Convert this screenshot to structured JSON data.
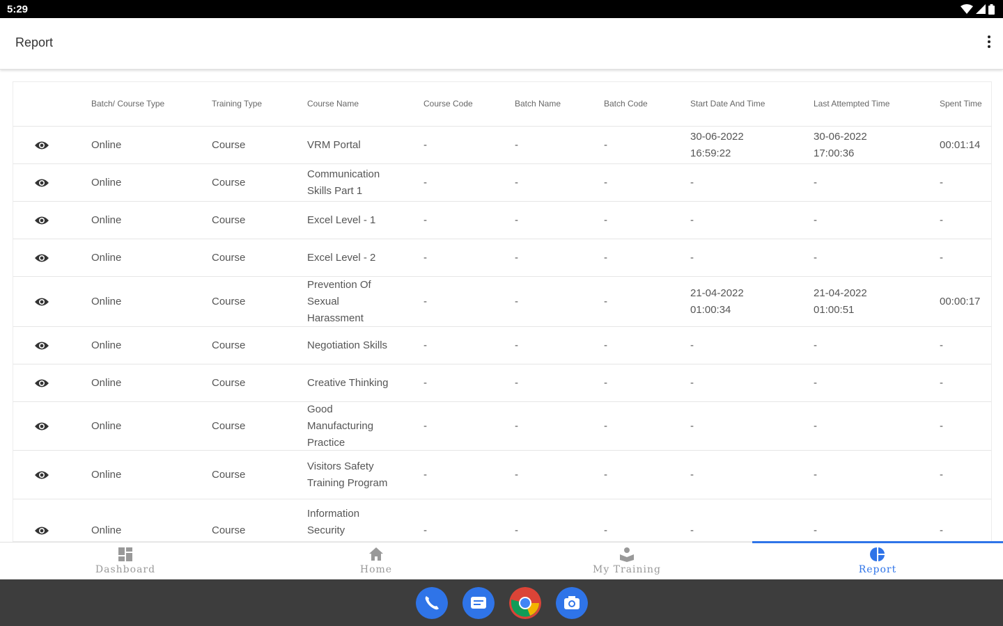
{
  "status_bar": {
    "time": "5:29"
  },
  "app_bar": {
    "title": "Report"
  },
  "table": {
    "headers": [
      "Batch/ Course Type",
      "Training Type",
      "Course Name",
      "Course Code",
      "Batch Name",
      "Batch Code",
      "Start Date And Time",
      "Last Attempted Time",
      "Spent Time"
    ],
    "rows": [
      {
        "type": "Online",
        "training": "Course",
        "name": "VRM Portal",
        "code": "-",
        "batch_name": "-",
        "batch_code": "-",
        "start": "30-06-2022 16:59:22",
        "last": "30-06-2022 17:00:36",
        "spent": "00:01:14"
      },
      {
        "type": "Online",
        "training": "Course",
        "name": "Communication Skills Part 1",
        "code": "-",
        "batch_name": "-",
        "batch_code": "-",
        "start": "-",
        "last": "-",
        "spent": "-"
      },
      {
        "type": "Online",
        "training": "Course",
        "name": "Excel Level - 1",
        "code": "-",
        "batch_name": "-",
        "batch_code": "-",
        "start": "-",
        "last": "-",
        "spent": "-"
      },
      {
        "type": "Online",
        "training": "Course",
        "name": "Excel Level - 2",
        "code": "-",
        "batch_name": "-",
        "batch_code": "-",
        "start": "-",
        "last": "-",
        "spent": "-"
      },
      {
        "type": "Online",
        "training": "Course",
        "name": "Prevention Of Sexual Harassment",
        "code": "-",
        "batch_name": "-",
        "batch_code": "-",
        "start": "21-04-2022 01:00:34",
        "last": "21-04-2022 01:00:51",
        "spent": "00:00:17"
      },
      {
        "type": "Online",
        "training": "Course",
        "name": "Negotiation Skills",
        "code": "-",
        "batch_name": "-",
        "batch_code": "-",
        "start": "-",
        "last": "-",
        "spent": "-"
      },
      {
        "type": "Online",
        "training": "Course",
        "name": "Creative Thinking",
        "code": "-",
        "batch_name": "-",
        "batch_code": "-",
        "start": "-",
        "last": "-",
        "spent": "-"
      },
      {
        "type": "Online",
        "training": "Course",
        "name": "Good Manufacturing Practice",
        "code": "-",
        "batch_name": "-",
        "batch_code": "-",
        "start": "-",
        "last": "-",
        "spent": "-"
      },
      {
        "type": "Online",
        "training": "Course",
        "name": "Visitors Safety Training Program",
        "code": "-",
        "batch_name": "-",
        "batch_code": "-",
        "start": "-",
        "last": "-",
        "spent": "-"
      },
      {
        "type": "Online",
        "training": "Course",
        "name": "Information Security Management",
        "code": "-",
        "batch_name": "-",
        "batch_code": "-",
        "start": "-",
        "last": "-",
        "spent": "-"
      }
    ]
  },
  "bottom_nav": {
    "items": [
      {
        "label": "Dashboard",
        "icon": "dashboard-icon"
      },
      {
        "label": "Home",
        "icon": "home-icon"
      },
      {
        "label": "My Training",
        "icon": "training-icon"
      },
      {
        "label": "Report",
        "icon": "report-icon"
      }
    ],
    "active_index": 3
  },
  "dock": {
    "apps": [
      "phone-app-icon",
      "messages-app-icon",
      "chrome-app-icon",
      "camera-app-icon"
    ]
  },
  "colors": {
    "accent": "#2f74e8",
    "status_bar": "#000000",
    "dock": "#3d3d3d"
  }
}
